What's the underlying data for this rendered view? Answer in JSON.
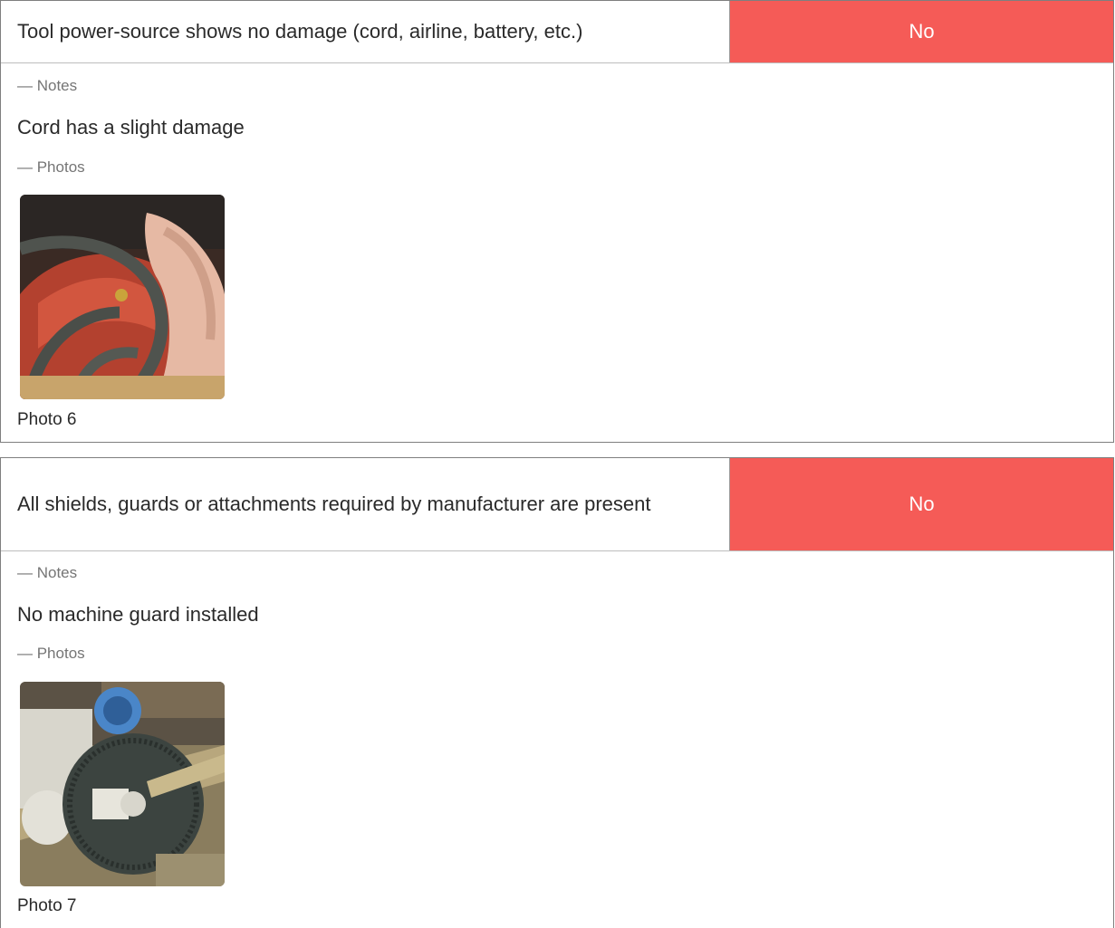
{
  "items": [
    {
      "question": "Tool power-source shows no damage (cord, airline, battery, etc.)",
      "answer": "No",
      "notes_label": "— Notes",
      "note": "Cord has a slight damage",
      "photos_label": "— Photos",
      "photo_caption": "Photo 6"
    },
    {
      "question": "All shields, guards or attachments required by manufacturer are present",
      "answer": "No",
      "notes_label": "— Notes",
      "note": "No machine guard installed",
      "photos_label": "— Photos",
      "photo_caption": "Photo 7"
    }
  ],
  "colors": {
    "answer_no_bg": "#f55b57",
    "answer_text": "#ffffff"
  }
}
